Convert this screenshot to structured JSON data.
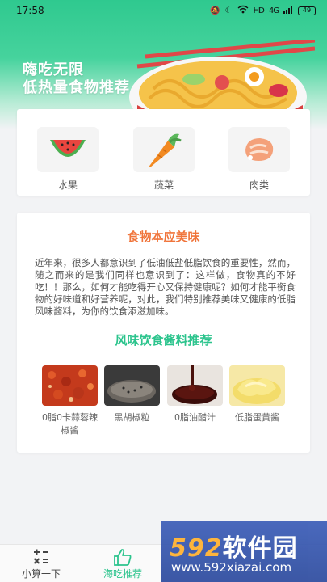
{
  "status_bar": {
    "time": "17:58",
    "network": "HD",
    "signal": "4G",
    "battery": "49"
  },
  "hero": {
    "title_line1": "嗨吃无限",
    "title_line2": "低热量食物推荐"
  },
  "categories": [
    {
      "label": "水果",
      "icon": "watermelon-icon"
    },
    {
      "label": "蔬菜",
      "icon": "carrot-icon"
    },
    {
      "label": "肉类",
      "icon": "meat-icon"
    }
  ],
  "article": {
    "title": "食物本应美味",
    "body": "近年来，很多人都意识到了低油低盐低脂饮食的重要性，然而，随之而来的是我们同样也意识到了：这样做，食物真的不好吃！！那么，如何才能吃得开心又保持健康呢？如何才能平衡食物的好味道和好营养呢，对此，我们特别推荐美味又健康的低脂风味酱料，为你的饮食添滋加味。"
  },
  "sauces": {
    "title": "风味饮食酱料推荐",
    "items": [
      {
        "label": "0脂0卡蒜蓉辣椒酱"
      },
      {
        "label": "黑胡椒粒"
      },
      {
        "label": "0脂油醋汁"
      },
      {
        "label": "低脂蛋黄酱"
      }
    ]
  },
  "tabbar": {
    "tabs": [
      {
        "label": "小算一下",
        "icon": "calculator-icon"
      },
      {
        "label": "海吃推荐",
        "icon": "thumbs-up-icon",
        "active": true
      }
    ]
  },
  "watermark": {
    "brand_num": "592",
    "brand_text": "软件园",
    "url": "www.592xiazai.com"
  },
  "colors": {
    "accent": "#2cc48d",
    "orange_title": "#f0743a"
  }
}
